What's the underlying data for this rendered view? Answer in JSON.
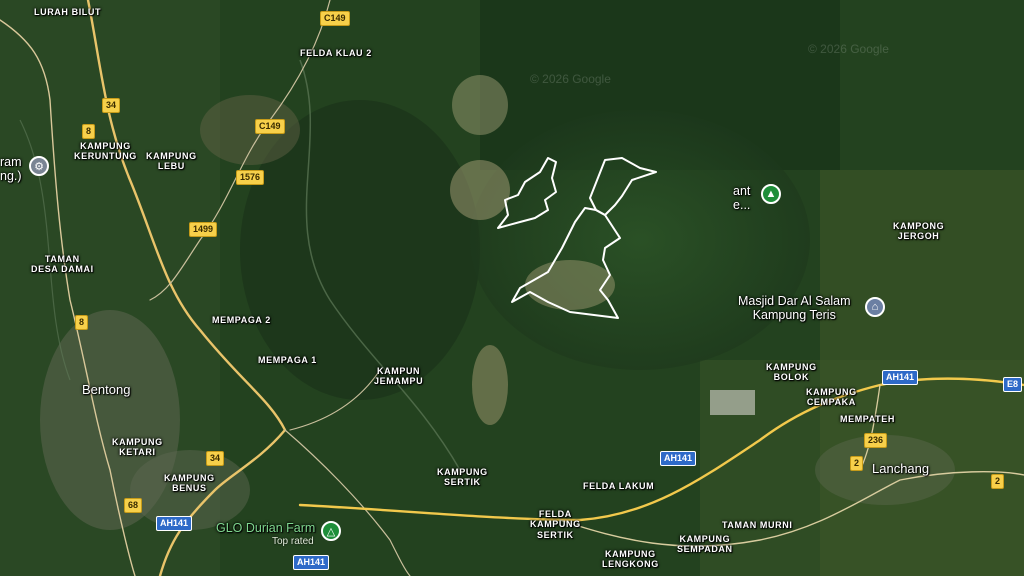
{
  "map": {
    "type": "satellite",
    "watermarks": [
      "© 2026 Google",
      "© 2026 Google"
    ]
  },
  "places": {
    "lurah_bilut": "LURAH BILUT",
    "felda_klau_2": "FELDA KLAU 2",
    "kampung_keruntung": "KAMPUNG\nKERUNTUNG",
    "kampung_lebu": "KAMPUNG\nLEBU",
    "taman_desa_damai": "TAMAN\nDESA DAMAI",
    "mempaga_2": "MEMPAGA 2",
    "mempaga_1": "MEMPAGA 1",
    "kampun_jemampu": "KAMPUN\nJEMAMPU",
    "bentong": "Bentong",
    "kampung_ketari": "KAMPUNG\nKETARI",
    "kampung_benus": "KAMPUNG\nBENUS",
    "kampung_sertik": "KAMPUNG\nSERTIK",
    "felda_lakum": "FELDA LAKUM",
    "felda_kampung_sertik": "FELDA\nKAMPUNG\nSERTIK",
    "kampung_lengkong": "KAMPUNG\nLENGKONG",
    "kampung_sempadan": "KAMPUNG\nSEMPADAN",
    "taman_murni": "TAMAN MURNI",
    "kampung_bolok": "KAMPUNG\nBOLOK",
    "kampung_cempaka": "KAMPUNG\nCEMPAKA",
    "mempateh": "MEMPATEH",
    "lanchang": "Lanchang",
    "kampong_jergoh": "KAMPONG\nJERGOH",
    "left_edge_poi": "ram\nng.)"
  },
  "pois": {
    "masjid": "Masjid Dar Al Salam\nKampung Teris",
    "park_partial": "ant\ne...",
    "glo_durian": "GLO Durian Farm",
    "glo_durian_sub": "Top rated"
  },
  "shields": {
    "c149_top": "C149",
    "c149_mid": "C149",
    "r34_top": "34",
    "r8_top": "8",
    "r1576": "1576",
    "r1499": "1499",
    "r8_mid": "8",
    "r34_bottom": "34",
    "r68": "68",
    "ah141_left": "AH141",
    "ah141_bottom": "AH141",
    "ah141_center": "AH141",
    "ah141_right": "AH141",
    "e8": "E8",
    "r236": "236",
    "r2_mid": "2",
    "r2_right": "2"
  },
  "icons": {
    "settings_pin": "gear-icon",
    "tree_pin": "tree-icon",
    "mosque_pin": "mosque-icon",
    "camp_pin": "tent-icon"
  },
  "colors": {
    "forest": "#20401f",
    "road_yellow": "#f2c94c",
    "boundary": "#ffffff",
    "pin_green": "#1f8e3a",
    "pin_grey": "#7a8594",
    "pin_blue_grey": "#6b7fa3"
  }
}
